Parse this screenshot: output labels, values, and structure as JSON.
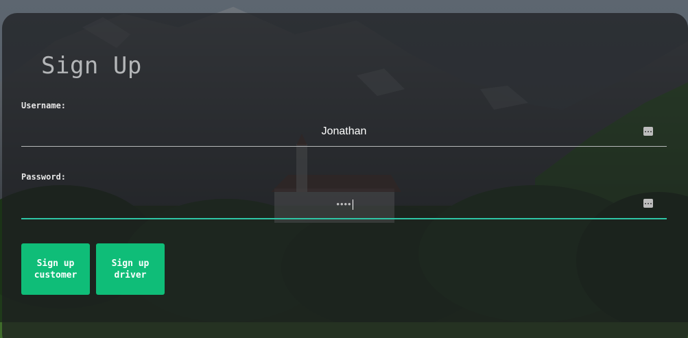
{
  "form": {
    "title": "Sign Up",
    "username": {
      "label": "Username:",
      "value": "Jonathan"
    },
    "password": {
      "label": "Password:",
      "masked_value": "••••"
    },
    "buttons": {
      "customer_label": "Sign up customer",
      "driver_label": "Sign up driver"
    }
  },
  "colors": {
    "button": "#0fbd78",
    "active_underline": "#2ec6a6",
    "panel": "rgba(28,30,33,0.74)",
    "title": "#b4b6b8"
  },
  "icons": {
    "field_trailing_icon": "more-horizontal-icon"
  }
}
